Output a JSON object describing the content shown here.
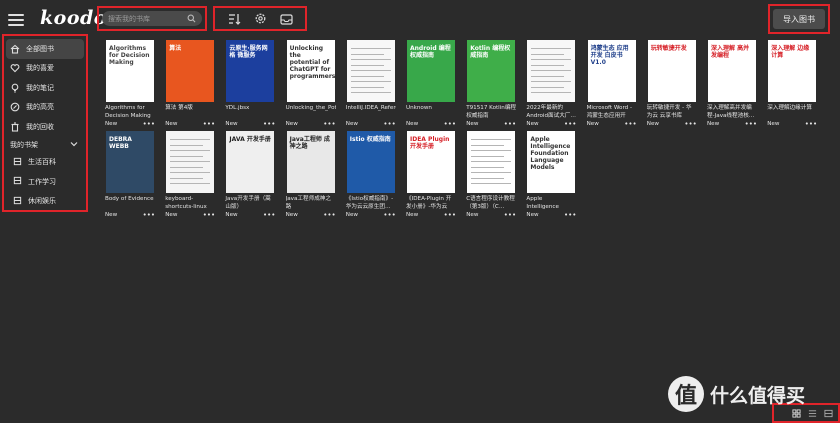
{
  "app": {
    "logo": "koodo"
  },
  "search": {
    "placeholder": "搜索我的书库"
  },
  "header": {
    "import_label": "导入图书"
  },
  "sidebar": {
    "items": [
      {
        "label": "全部图书",
        "icon": "home-icon",
        "active": true
      },
      {
        "label": "我的喜爱",
        "icon": "heart-icon",
        "active": false
      },
      {
        "label": "我的笔记",
        "icon": "bulb-icon",
        "active": false
      },
      {
        "label": "我的高亮",
        "icon": "highlight-icon",
        "active": false
      },
      {
        "label": "我的回收",
        "icon": "trash-icon",
        "active": false
      }
    ],
    "shelf_title": "我的书架",
    "shelves": [
      {
        "label": "生活百科"
      },
      {
        "label": "工作学习"
      },
      {
        "label": "休闲娱乐"
      }
    ]
  },
  "books": [
    {
      "title": "Algorithms for Decision Making",
      "status": "New",
      "cover": {
        "bg": "#ffffff",
        "fg": "#444444",
        "text": "Algorithms for Decision Making"
      }
    },
    {
      "title": "算法 第4版",
      "status": "New",
      "cover": {
        "bg": "#e8561f",
        "fg": "#ffffff",
        "text": "算法"
      }
    },
    {
      "title": "YDL.jbsx",
      "status": "New",
      "cover": {
        "bg": "#1c3f9e",
        "fg": "#ffffff",
        "text": "云原生·服务网格 微服务"
      }
    },
    {
      "title": "Unlocking_the_Potential",
      "status": "New",
      "cover": {
        "bg": "#ffffff",
        "fg": "#333333",
        "text": "Unlocking the potential of ChatGPT for programmers"
      }
    },
    {
      "title": "IntelliJ.IDEA_Reference",
      "status": "New",
      "cover": {
        "bg": "#f7f7f7",
        "fg": "#555555",
        "text": ""
      }
    },
    {
      "title": "Unknown",
      "status": "New",
      "cover": {
        "bg": "#38a84a",
        "fg": "#ffffff",
        "text": "Android 编程权威指南"
      }
    },
    {
      "title": "T91517 Kotlin编程权威指南",
      "status": "New",
      "cover": {
        "bg": "#3fae49",
        "fg": "#ffffff",
        "text": "Kotlin 编程权威指南"
      }
    },
    {
      "title": "2022年最新的Android面试大厂…",
      "status": "New",
      "cover": {
        "bg": "#f7f7f7",
        "fg": "#555555",
        "text": ""
      }
    },
    {
      "title": "Microsoft Word - 鸿蒙生态应用开发…",
      "status": "New",
      "cover": {
        "bg": "#ffffff",
        "fg": "#1f3f8a",
        "text": "鸿蒙生态 应用开发 白皮书 V1.0"
      }
    },
    {
      "title": "玩转敏捷开发 - 华为云 云享书库",
      "status": "New",
      "cover": {
        "bg": "#ffffff",
        "fg": "#d62027",
        "text": "玩转敏捷开发"
      }
    },
    {
      "title": "深入理解高并发编程-Java线程池核…",
      "status": "New",
      "cover": {
        "bg": "#ffffff",
        "fg": "#d62027",
        "text": "深入理解 高并发编程"
      }
    },
    {
      "title": "深入理解边缘计算",
      "status": "New",
      "cover": {
        "bg": "#ffffff",
        "fg": "#d62027",
        "text": "深入理解 边缘计算"
      }
    },
    {
      "title": "Body of Evidence",
      "status": "New",
      "cover": {
        "bg": "#2f4a66",
        "fg": "#ffffff",
        "text": "DEBRA WEBB"
      }
    },
    {
      "title": "keyboard-shortcuts-linux",
      "status": "New",
      "cover": {
        "bg": "#f4f4f4",
        "fg": "#555555",
        "text": ""
      }
    },
    {
      "title": "Java开发手册（嵩山版）",
      "status": "New",
      "cover": {
        "bg": "#efefef",
        "fg": "#222222",
        "text": "JAVA 开发手册"
      }
    },
    {
      "title": "Java工程师成神之路",
      "status": "New",
      "cover": {
        "bg": "#e8e8e8",
        "fg": "#222222",
        "text": "Java工程师 成神之路"
      }
    },
    {
      "title": "《Istio权威指南》-华为云云原生团…",
      "status": "New",
      "cover": {
        "bg": "#1f5aa8",
        "fg": "#ffffff",
        "text": "Istio 权威指南"
      }
    },
    {
      "title": "《IDEA-Plugin 开发小册》-华为云社…",
      "status": "New",
      "cover": {
        "bg": "#ffffff",
        "fg": "#d62027",
        "text": "IDEA Plugin 开发手册"
      }
    },
    {
      "title": "C语言程序设计教程（第3版）（C…",
      "status": "New",
      "cover": {
        "bg": "#ffffff",
        "fg": "#666666",
        "text": ""
      }
    },
    {
      "title": "Apple Intelligence Foundation…",
      "status": "New",
      "cover": {
        "bg": "#ffffff",
        "fg": "#333333",
        "text": "Apple Intelligence Foundation Language Models"
      }
    }
  ],
  "view": {
    "icons": [
      "grid-view-icon",
      "list-view-icon",
      "cover-view-icon"
    ]
  },
  "watermark": {
    "glyph": "值",
    "text": "什么值得买"
  },
  "colors": {
    "background": "#2b2b2b",
    "highlight_border": "#e0242a",
    "active_item": "#454545"
  }
}
